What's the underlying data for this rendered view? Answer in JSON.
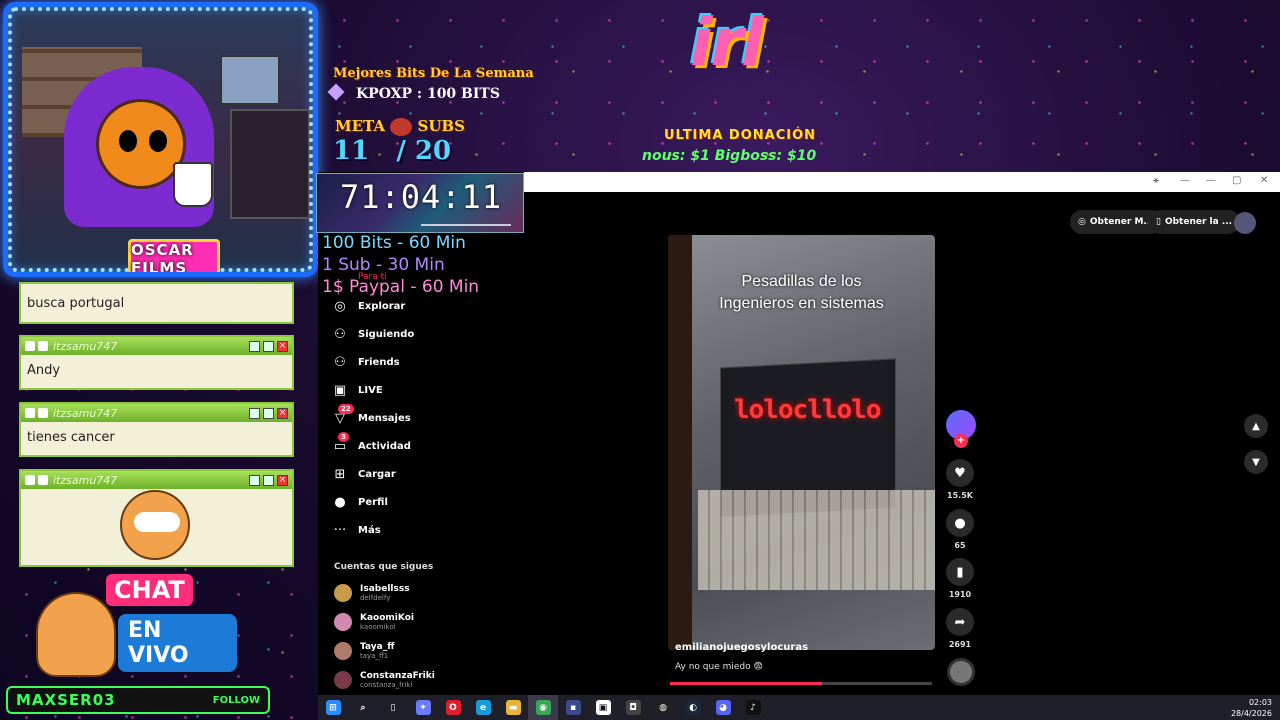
{
  "overlay": {
    "bits_title": "Mejores Bits De La Semana",
    "bits_line": "KPOXP :  100 BITS",
    "meta_label": "META",
    "subs_label": "SUBS",
    "meta_current": "11",
    "meta_goal": "/ 20",
    "logo_text": "irl",
    "ultima_label": "ULTIMA DONACIÓN",
    "donations": "nous: $1   Bigboss: $10",
    "timer": "71:04:11",
    "rewards": [
      "100 Bits - 60 Min",
      "1 Sub - 30 Min",
      "1$ Paypal - 60 Min"
    ],
    "cam_logo": "OSCAR FILMS"
  },
  "chat": {
    "messages": [
      {
        "user": "",
        "text": "busca portugal"
      },
      {
        "user": "itzsamu747",
        "text": "Andy"
      },
      {
        "user": "itzsamu747",
        "text": "tienes cancer"
      },
      {
        "user": "itzsamu747",
        "text": ""
      }
    ],
    "chat_label": "CHAT",
    "envivo_label": "EN VIVO",
    "streamer": "MAXSER03",
    "follow": "FOLLOW"
  },
  "tiktok": {
    "para_ti": "Para ti",
    "nav": [
      {
        "icon": "compass-icon",
        "glyph": "◎",
        "label": "Explorar",
        "badge": ""
      },
      {
        "icon": "following-icon",
        "glyph": "⚇",
        "label": "Siguiendo",
        "badge": ""
      },
      {
        "icon": "friends-icon",
        "glyph": "⚇",
        "label": "Friends",
        "badge": ""
      },
      {
        "icon": "live-icon",
        "glyph": "▣",
        "label": "LIVE",
        "badge": ""
      },
      {
        "icon": "messages-icon",
        "glyph": "▽",
        "label": "Mensajes",
        "badge": "22"
      },
      {
        "icon": "activity-icon",
        "glyph": "▭",
        "label": "Actividad",
        "badge": "3"
      },
      {
        "icon": "upload-icon",
        "glyph": "⊞",
        "label": "Cargar",
        "badge": ""
      },
      {
        "icon": "profile-icon",
        "glyph": "●",
        "label": "Perfil",
        "badge": ""
      },
      {
        "icon": "more-icon",
        "glyph": "···",
        "label": "Más",
        "badge": ""
      }
    ],
    "following_header": "Cuentas que sigues",
    "accounts": [
      {
        "name": "Isabellsss",
        "handle": "delfdelfy",
        "color": "#c99a4a"
      },
      {
        "name": "KaoomiKoi",
        "handle": "kaoomikoi",
        "color": "#d08ab0"
      },
      {
        "name": "Taya_ff",
        "handle": "taya_ff1",
        "color": "#b07a6a"
      },
      {
        "name": "ConstanzaFriki",
        "handle": "constanza_friki",
        "color": "#7a3a4a"
      }
    ],
    "top_buttons": [
      "Obtener M...",
      "Obtener la ..."
    ],
    "video": {
      "caption_line1": "Pesadillas de los",
      "caption_line2": "Ingenieros en sistemas",
      "led_text": "lolocllolo",
      "username": "emilianojuegosylocuras",
      "description": "Ay no que miedo 😨",
      "progress": 0.58
    },
    "actions": [
      {
        "icon": "heart-icon",
        "glyph": "♥",
        "count": "15.5K"
      },
      {
        "icon": "comment-icon",
        "glyph": "●",
        "count": "65"
      },
      {
        "icon": "bookmark-icon",
        "glyph": "▮",
        "count": "1910"
      },
      {
        "icon": "share-icon",
        "glyph": "➦",
        "count": "2691"
      }
    ],
    "plus": "+"
  },
  "taskbar": {
    "apps": [
      {
        "icon": "windows-icon",
        "glyph": "⊞",
        "color": "#2b8cff"
      },
      {
        "icon": "search-icon",
        "glyph": "⌕",
        "color": "transparent"
      },
      {
        "icon": "task-view-icon",
        "glyph": "▯",
        "color": "transparent"
      },
      {
        "icon": "copilot-icon",
        "glyph": "✦",
        "color": "#6a7bff"
      },
      {
        "icon": "opera-icon",
        "glyph": "O",
        "color": "#e01e2a"
      },
      {
        "icon": "edge-icon",
        "glyph": "e",
        "color": "#1a9bd8"
      },
      {
        "icon": "explorer-icon",
        "glyph": "▬",
        "color": "#e8b43a"
      },
      {
        "icon": "chrome-icon",
        "glyph": "◉",
        "color": "#3aa757"
      },
      {
        "icon": "app-icon",
        "glyph": "▪",
        "color": "#3a4a8a"
      },
      {
        "icon": "capcut-icon",
        "glyph": "▣",
        "color": "#fff"
      },
      {
        "icon": "vr-icon",
        "glyph": "◘",
        "color": "#444"
      },
      {
        "icon": "obs-icon",
        "glyph": "◍",
        "color": "#222"
      },
      {
        "icon": "steam-icon",
        "glyph": "◐",
        "color": "#1b2838"
      },
      {
        "icon": "discord-icon",
        "glyph": "◕",
        "color": "#5865f2"
      },
      {
        "icon": "tiktok-icon",
        "glyph": "♪",
        "color": "#111"
      }
    ],
    "time": "02:03",
    "date": "28/4/2026"
  }
}
